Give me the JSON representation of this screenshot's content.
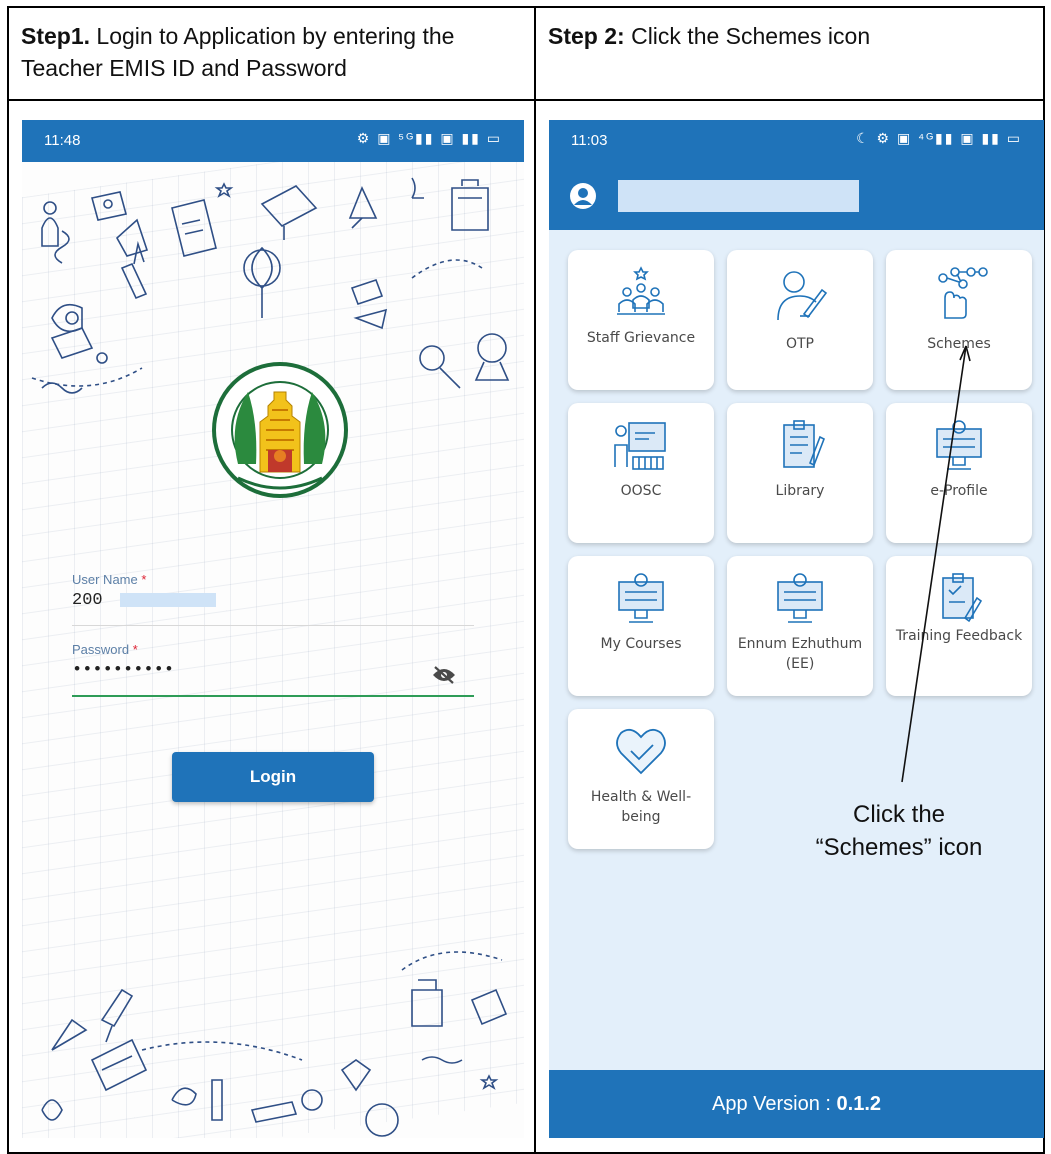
{
  "steps": [
    {
      "label": "Step1.",
      "text": " Login to Application by entering the Teacher EMIS ID and Password"
    },
    {
      "label": "Step 2:",
      "text": " Click the Schemes icon"
    }
  ],
  "login_screen": {
    "status_time": "11:48",
    "status_icons": "⚙ ▣ ⁵ᴳ▮▮ ▣ ▮▮ ▭",
    "username": {
      "label": "User Name",
      "required_mark": "*",
      "value": "200"
    },
    "password": {
      "label": "Password",
      "required_mark": "*",
      "value": "••••••••••"
    },
    "login_button": "Login"
  },
  "home_screen": {
    "status_time": "11:03",
    "status_icons": "☾ ⚙ ▣ ⁴ᴳ▮▮ ▣ ▮▮ ▭",
    "tiles": [
      {
        "label": "Staff Grievance",
        "icon": "staff-grievance-icon"
      },
      {
        "label": "OTP",
        "icon": "otp-icon"
      },
      {
        "label": "Schemes",
        "icon": "schemes-icon"
      },
      {
        "label": "OOSC",
        "icon": "oosc-icon"
      },
      {
        "label": "Library",
        "icon": "library-icon"
      },
      {
        "label": "e-Profile",
        "icon": "e-profile-icon"
      },
      {
        "label": "My Courses",
        "icon": "my-courses-icon"
      },
      {
        "label": "Ennum Ezhuthum (EE)",
        "icon": "ennum-ezhuthum-icon"
      },
      {
        "label": "Training Feedback",
        "icon": "training-feedback-icon"
      },
      {
        "label": "Health & Well-being",
        "icon": "health-wellbeing-icon"
      }
    ],
    "annotation_line1": "Click the",
    "annotation_line2": "“Schemes” icon",
    "footer_prefix": "App Version : ",
    "footer_version": "0.1.2"
  },
  "colors": {
    "primary": "#1f73b9",
    "screen_bg": "#e3effa",
    "active_underline": "#2e9c57"
  }
}
